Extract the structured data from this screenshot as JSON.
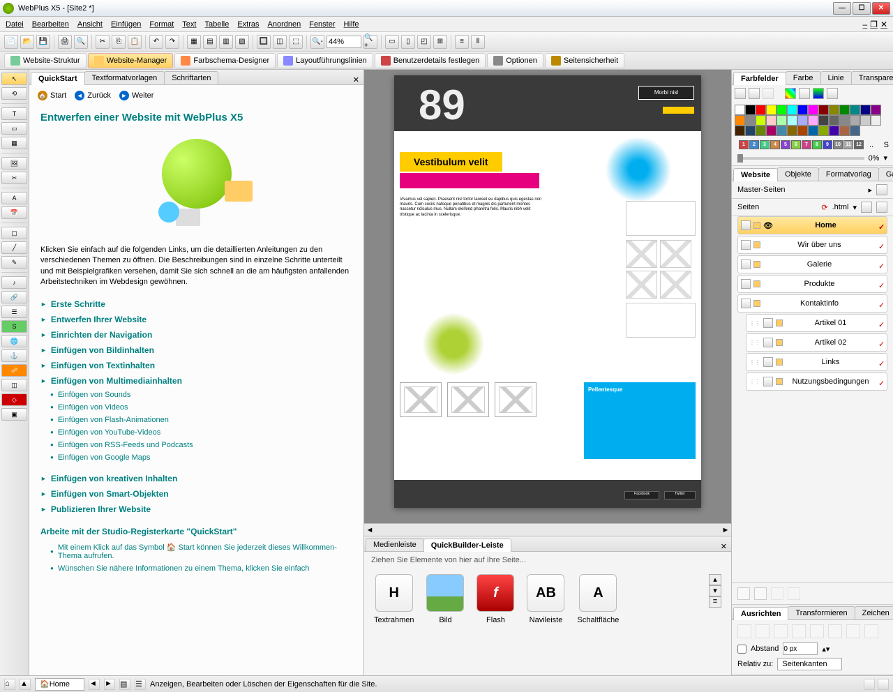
{
  "title": "WebPlus X5 - [Site2 *]",
  "menu": [
    "Datei",
    "Bearbeiten",
    "Ansicht",
    "Einfügen",
    "Format",
    "Text",
    "Tabelle",
    "Extras",
    "Anordnen",
    "Fenster",
    "Hilfe"
  ],
  "zoom": "44%",
  "tabbar": [
    {
      "label": "Website-Struktur",
      "color": "#7c9"
    },
    {
      "label": "Website-Manager",
      "color": "#fc6",
      "active": true
    },
    {
      "label": "Farbschema-Designer",
      "color": "#f84"
    },
    {
      "label": "Layoutführungslinien",
      "color": "#88f"
    },
    {
      "label": "Benutzerdetails festlegen",
      "color": "#c44"
    },
    {
      "label": "Optionen",
      "color": "#888"
    },
    {
      "label": "Seitensicherheit",
      "color": "#b80"
    }
  ],
  "leftPanel": {
    "tabs": [
      "QuickStart",
      "Textformatvorlagen",
      "Schriftarten"
    ],
    "nav": {
      "start": "Start",
      "back": "Zurück",
      "fwd": "Weiter"
    },
    "title": "Entwerfen einer Website mit WebPlus X5",
    "intro": "Klicken Sie einfach auf die folgenden Links, um die detaillierten Anleitungen zu den verschiedenen Themen zu öffnen. Die Beschreibungen sind in einzelne Schritte unterteilt und mit Beispielgrafiken versehen, damit Sie sich schnell an die am häufigsten anfallenden Arbeitstechniken im Webdesign gewöhnen.",
    "links": [
      "Erste Schritte",
      "Entwerfen Ihrer Website",
      "Einrichten der Navigation",
      "Einfügen von Bildinhalten",
      "Einfügen von Textinhalten",
      "Einfügen von Multimediainhalten"
    ],
    "sublinks": [
      "Einfügen von Sounds",
      "Einfügen von Videos",
      "Einfügen von Flash-Animationen",
      "Einfügen von YouTube-Videos",
      "Einfügen von RSS-Feeds und Podcasts",
      "Einfügen von Google Maps"
    ],
    "links2": [
      "Einfügen von kreativen Inhalten",
      "Einfügen von Smart-Objekten",
      "Publizieren Ihrer Website"
    ],
    "section": "Arbeite mit der Studio-Registerkarte \"QuickStart\"",
    "foot1": "Mit einem Klick auf das Symbol 🏠 Start können Sie jederzeit dieses Willkommen-Thema aufrufen.",
    "foot2": "Wünschen Sie nähere Informationen zu einem Thema, klicken Sie einfach"
  },
  "canvas": {
    "big": "89",
    "morbi": "Morbi nisl",
    "title": "Vestibulum velit",
    "body": "Vivamus vel sapien. Praesent nisl tortor laoreet eu dapibus quis egestas non mauris. Cum sociis natoque penatibus et magnis dis parturient montes nascetur ridiculus mus. Nullam eleifend pharetra felis. Mauris nibh velit tristique ac lacinia in scelerisque.",
    "blue": "Pellentesque",
    "fb": "Facebook",
    "tw": "Twitter"
  },
  "bottomPanel": {
    "tabs": [
      "Medienleiste",
      "QuickBuilder-Leiste"
    ],
    "hint": "Ziehen Sie Elemente von hier auf Ihre Seite...",
    "items": [
      {
        "label": "Textrahmen",
        "t": "H"
      },
      {
        "label": "Bild",
        "t": "img"
      },
      {
        "label": "Flash",
        "t": "f"
      },
      {
        "label": "Navileiste",
        "t": "AB"
      },
      {
        "label": "Schaltfläche",
        "t": "A"
      }
    ]
  },
  "rightTop": {
    "tabs": [
      "Farbfelder",
      "Farbe",
      "Linie",
      "Transparenz"
    ],
    "s": "S",
    "pct": "0%"
  },
  "swatches": [
    "#fff",
    "#000",
    "#f00",
    "#ff0",
    "#0f0",
    "#0ff",
    "#00f",
    "#f0f",
    "#800",
    "#880",
    "#080",
    "#088",
    "#008",
    "#808",
    "#f80",
    "#888",
    "#cf0",
    "#fcc",
    "#afa",
    "#aff",
    "#aaf",
    "#faf",
    "#444",
    "#666",
    "#888",
    "#aaa",
    "#ccc",
    "#eee",
    "#420",
    "#246",
    "#680",
    "#a06",
    "#48a",
    "#860",
    "#a40",
    "#06a",
    "#8a0",
    "#40a",
    "#a64",
    "#468"
  ],
  "colorNums": [
    "1",
    "2",
    "3",
    "4",
    "5",
    "6",
    "7",
    "8",
    "9",
    "10",
    "11",
    "12"
  ],
  "website": {
    "tabs": [
      "Website",
      "Objekte",
      "Formatvorlag",
      "Galerie"
    ],
    "master": "Master-Seiten",
    "seiten": "Seiten",
    "ext": ".html",
    "pages": [
      {
        "label": "Home",
        "home": true
      },
      {
        "label": "Wir über uns"
      },
      {
        "label": "Galerie"
      },
      {
        "label": "Produkte"
      },
      {
        "label": "Kontaktinfo"
      },
      {
        "label": "Artikel 01",
        "sub": true
      },
      {
        "label": "Artikel 02",
        "sub": true
      },
      {
        "label": "Links",
        "sub": true
      },
      {
        "label": "Nutzungsbedingungen",
        "sub": true
      }
    ]
  },
  "align": {
    "tabs": [
      "Ausrichten",
      "Transformieren",
      "Zeichen"
    ],
    "abstand": "Abstand",
    "px": "0 px",
    "relativ": "Relativ zu:",
    "seitenkanten": "Seitenkanten"
  },
  "status": {
    "home": "Home",
    "msg": "Anzeigen, Bearbeiten oder Löschen der Eigenschaften für die Site."
  }
}
